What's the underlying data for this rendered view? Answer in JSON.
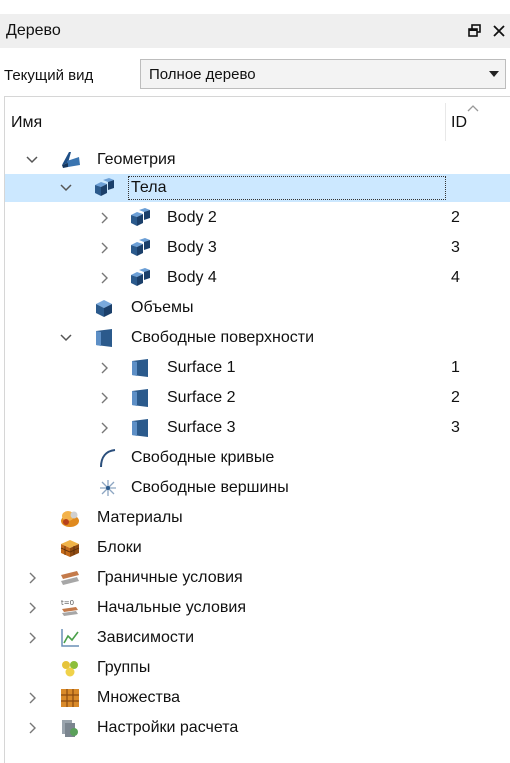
{
  "panel": {
    "title": "Дерево",
    "float_icon": "restore-window-icon",
    "close_icon": "close-icon"
  },
  "view_selector": {
    "label": "Текущий вид",
    "value": "Полное дерево"
  },
  "tree": {
    "columns": {
      "name": "Имя",
      "id": "ID"
    },
    "rows": [
      {
        "label": "Геометрия",
        "id": "",
        "icon": "geometry-icon",
        "expander": "expanded"
      },
      {
        "label": "Тела",
        "id": "",
        "icon": "bodies-icon",
        "expander": "expanded",
        "selected": true
      },
      {
        "label": "Body 2",
        "id": "2",
        "icon": "body-icon",
        "expander": "collapsed"
      },
      {
        "label": "Body 3",
        "id": "3",
        "icon": "body-icon",
        "expander": "collapsed"
      },
      {
        "label": "Body 4",
        "id": "4",
        "icon": "body-icon",
        "expander": "collapsed"
      },
      {
        "label": "Объемы",
        "id": "",
        "icon": "volumes-icon",
        "expander": "none"
      },
      {
        "label": "Свободные поверхности",
        "id": "",
        "icon": "surfaces-icon",
        "expander": "expanded"
      },
      {
        "label": "Surface 1",
        "id": "1",
        "icon": "surface-icon",
        "expander": "collapsed"
      },
      {
        "label": "Surface 2",
        "id": "2",
        "icon": "surface-icon",
        "expander": "collapsed"
      },
      {
        "label": "Surface 3",
        "id": "3",
        "icon": "surface-icon",
        "expander": "collapsed"
      },
      {
        "label": "Свободные кривые",
        "id": "",
        "icon": "curve-icon",
        "expander": "none"
      },
      {
        "label": "Свободные вершины",
        "id": "",
        "icon": "vertex-icon",
        "expander": "none"
      },
      {
        "label": "Материалы",
        "id": "",
        "icon": "materials-icon",
        "expander": "none"
      },
      {
        "label": "Блоки",
        "id": "",
        "icon": "blocks-icon",
        "expander": "none"
      },
      {
        "label": "Граничные условия",
        "id": "",
        "icon": "boundary-conditions-icon",
        "expander": "collapsed"
      },
      {
        "label": "Начальные условия",
        "id": "",
        "icon": "initial-conditions-icon",
        "expander": "collapsed"
      },
      {
        "label": "Зависимости",
        "id": "",
        "icon": "dependencies-icon",
        "expander": "collapsed"
      },
      {
        "label": "Группы",
        "id": "",
        "icon": "groups-icon",
        "expander": "none"
      },
      {
        "label": "Множества",
        "id": "",
        "icon": "sets-icon",
        "expander": "collapsed"
      },
      {
        "label": "Настройки расчета",
        "id": "",
        "icon": "solver-settings-icon",
        "expander": "collapsed"
      }
    ]
  },
  "colors": {
    "selection": "#cce8ff",
    "titlebar": "#efefef",
    "icon_blue": "#2b5a8c"
  }
}
